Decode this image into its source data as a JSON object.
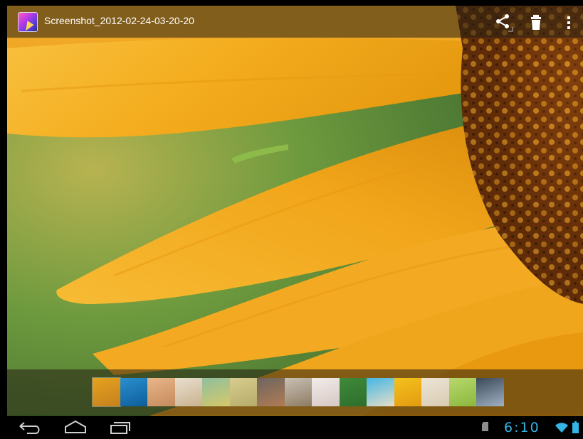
{
  "actionbar": {
    "title": "Screenshot_2012-02-24-03-20-20",
    "app_icon": "gallery-icon",
    "actions": [
      {
        "name": "share",
        "icon": "share-icon"
      },
      {
        "name": "delete",
        "icon": "trash-icon"
      },
      {
        "name": "more",
        "icon": "overflow-menu-icon"
      }
    ]
  },
  "photo": {
    "subject": "sunflower-closeup"
  },
  "filmstrip": {
    "thumbnails": [
      {
        "colors": [
          "#e6a21e",
          "#c5811d"
        ]
      },
      {
        "colors": [
          "#2a8fd0",
          "#0e5d9a"
        ]
      },
      {
        "colors": [
          "#e9b68a",
          "#c48a5c"
        ]
      },
      {
        "colors": [
          "#e9dfcf",
          "#c9b28e"
        ]
      },
      {
        "colors": [
          "#8fbf9d",
          "#d6c86a"
        ]
      },
      {
        "colors": [
          "#d7cd8e",
          "#b7ab6a"
        ]
      },
      {
        "colors": [
          "#6e6560",
          "#b07c54"
        ]
      },
      {
        "colors": [
          "#c8c1b6",
          "#8e7b62"
        ]
      },
      {
        "colors": [
          "#f1ecea",
          "#d7c8c4"
        ]
      },
      {
        "colors": [
          "#3f8a3a",
          "#2d6e2c"
        ]
      },
      {
        "colors": [
          "#44b6e6",
          "#e6dfc6"
        ]
      },
      {
        "colors": [
          "#f4c21c",
          "#e39a11"
        ]
      },
      {
        "colors": [
          "#ece4d6",
          "#d9cbb1"
        ]
      },
      {
        "colors": [
          "#b8d86c",
          "#8ab83e"
        ]
      },
      {
        "colors": [
          "#3b4858",
          "#9fb2c4"
        ]
      }
    ]
  },
  "navbar": {
    "buttons": [
      {
        "name": "back",
        "icon": "back-icon"
      },
      {
        "name": "home",
        "icon": "home-icon"
      },
      {
        "name": "recents",
        "icon": "recent-apps-icon"
      }
    ]
  },
  "statusbar": {
    "time": "6:10",
    "icons": [
      "sd-card-icon",
      "wifi-icon",
      "battery-icon"
    ],
    "accent_color": "#33b5e5"
  }
}
